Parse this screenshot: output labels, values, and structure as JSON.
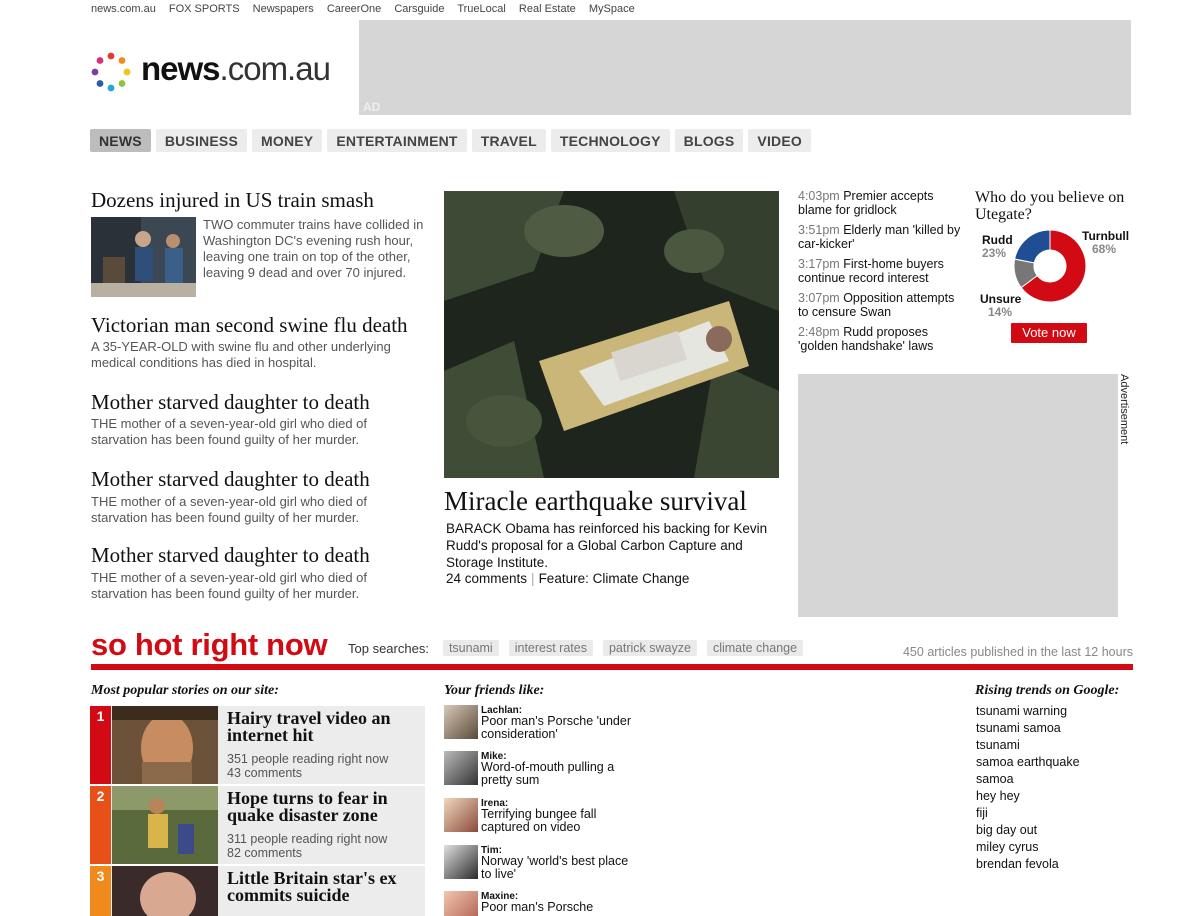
{
  "topbar": [
    "news.com.au",
    "FOX SPORTS",
    "Newspapers",
    "CareerOne",
    "Carsguide",
    "TrueLocal",
    "Real Estate",
    "MySpace"
  ],
  "logo": {
    "bold": "news",
    "light": ".com.au"
  },
  "ad_top": {
    "label": "AD"
  },
  "nav": [
    "NEWS",
    "BUSINESS",
    "MONEY",
    "ENTERTAINMENT",
    "TRAVEL",
    "TECHNOLOGY",
    "BLOGS",
    "VIDEO"
  ],
  "story1": {
    "title": "Dozens injured in US train smash",
    "text": "TWO commuter trains have collided in Washington DC's evening rush hour, leaving one train on top of the other, leaving 9 dead and over 70 injured."
  },
  "stories": [
    {
      "title": "Victorian man second swine flu death",
      "text": "A 35-YEAR-OLD with swine flu and other underlying medical conditions has died in hospital."
    },
    {
      "title": "Mother starved daughter to death",
      "text": "THE mother of a seven-year-old girl who died of starvation has been found guilty of her murder."
    },
    {
      "title": "Mother starved daughter to death",
      "text": "THE mother of a seven-year-old girl who died of starvation has been found guilty of her murder."
    },
    {
      "title": "Mother starved daughter to death",
      "text": "THE mother of a seven-year-old girl who died of starvation has been found guilty of her murder."
    }
  ],
  "feature": {
    "title": "Miracle earthquake survival",
    "text": "BARACK Obama has reinforced his backing for Kevin Rudd's proposal for a Global Carbon Capture and Storage Institute.",
    "comments": "24 comments",
    "feature_link": "Feature: Climate Change"
  },
  "latest": [
    {
      "time": "4:03pm",
      "text": "Premier accepts blame for gridlock"
    },
    {
      "time": "3:51pm",
      "text": "Elderly man 'killed by car-kicker'"
    },
    {
      "time": "3:17pm",
      "text": "First-home buyers continue record interest"
    },
    {
      "time": "3:07pm",
      "text": "Opposition attempts to censure Swan"
    },
    {
      "time": "2:48pm",
      "text": "Rudd proposes 'golden handshake' laws"
    }
  ],
  "poll": {
    "question": "Who do you believe on Utegate?",
    "options": [
      {
        "name": "Rudd",
        "pct": "23%",
        "value": 23,
        "color": "#1f4e94"
      },
      {
        "name": "Turnbull",
        "pct": "68%",
        "value": 68,
        "color": "#d10a13"
      },
      {
        "name": "Unsure",
        "pct": "14%",
        "value": 14,
        "color": "#777777"
      }
    ],
    "vote_label": "Vote now"
  },
  "ad_side": {
    "label": "Advertisement"
  },
  "hot": {
    "title": "so hot right now",
    "searches_label": "Top searches:",
    "searches": [
      "tsunami",
      "interest rates",
      "patrick swayze",
      "climate change"
    ],
    "count": "450 articles published in the last 12 hours"
  },
  "popular": {
    "heading": "Most popular stories on our site:",
    "items": [
      {
        "num": "1",
        "title": "Hairy travel video an internet hit",
        "reading": "351 people reading right now",
        "comments": "43 comments",
        "color": "#d10a13"
      },
      {
        "num": "2",
        "title": "Hope turns to fear in quake disaster zone",
        "reading": "311 people reading right now",
        "comments": "82 comments",
        "color": "#e8501a"
      },
      {
        "num": "3",
        "title": "Little Britain star's ex commits suicide",
        "reading": "",
        "comments": "",
        "color": "#f08a1c"
      }
    ]
  },
  "friends": {
    "heading": "Your friends like:",
    "items": [
      {
        "name": "Lachlan:",
        "text": "Poor man's Porsche 'under consideration'"
      },
      {
        "name": "Mike:",
        "text": "Word-of-mouth pulling a pretty sum"
      },
      {
        "name": "Irena:",
        "text": "Terrifying bungee fall captured on video"
      },
      {
        "name": "Tim:",
        "text": "Norway 'world's best place to live'"
      },
      {
        "name": "Maxine:",
        "text": "Poor man's Porsche"
      }
    ]
  },
  "trends": {
    "heading": "Rising trends on Google:",
    "items": [
      "tsunami warning",
      "tsunami samoa",
      "tsunami",
      "samoa earthquake",
      "samoa",
      "hey hey",
      "fiji",
      "big day out",
      "miley cyrus",
      "brendan fevola"
    ]
  }
}
